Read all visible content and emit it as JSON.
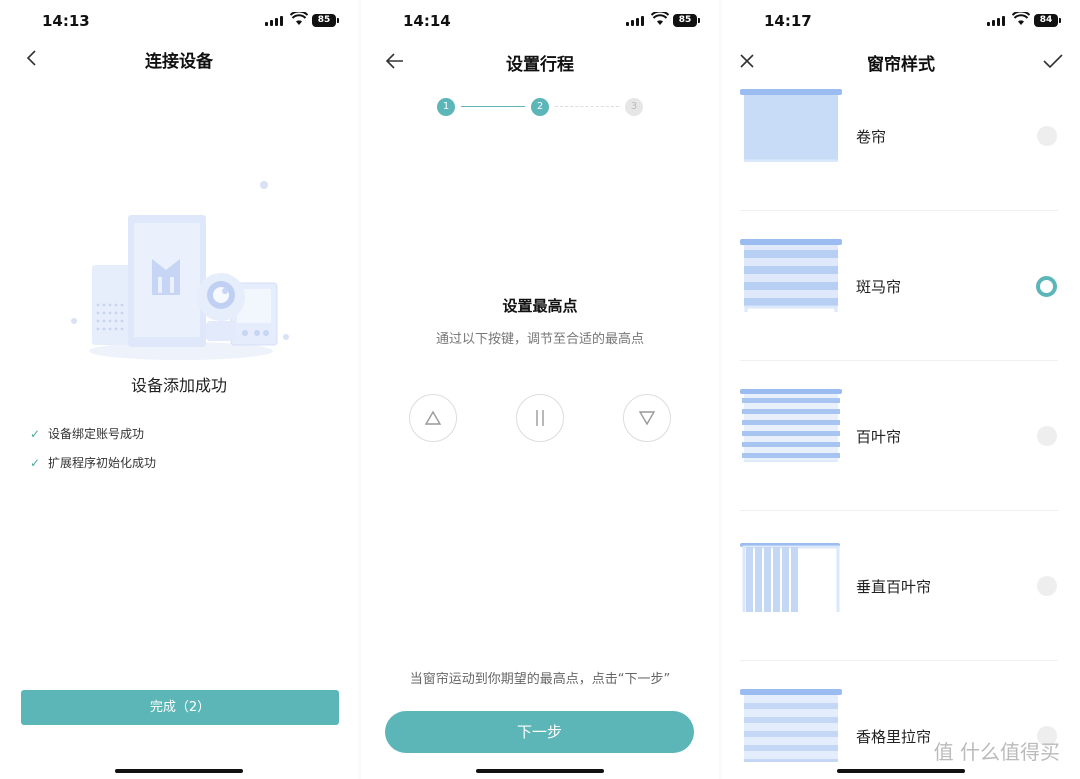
{
  "panel1": {
    "status": {
      "time": "14:13",
      "battery": "85"
    },
    "title": "连接设备",
    "success_text": "设备添加成功",
    "checks": [
      "设备绑定账号成功",
      "扩展程序初始化成功"
    ],
    "done_button": "完成（2）"
  },
  "panel2": {
    "status": {
      "time": "14:14",
      "battery": "85"
    },
    "title": "设置行程",
    "steps": [
      "1",
      "2",
      "3"
    ],
    "current_step": 2,
    "heading": "设置最高点",
    "subtitle": "通过以下按键，调节至合适的最高点",
    "controls": [
      "up-icon",
      "pause-icon",
      "down-icon"
    ],
    "hint": "当窗帘运动到你期望的最高点，点击“下一步”",
    "next_button": "下一步"
  },
  "panel3": {
    "status": {
      "time": "14:17",
      "battery": "84"
    },
    "title": "窗帘样式",
    "options": [
      {
        "label": "卷帘",
        "selected": false
      },
      {
        "label": "斑马帘",
        "selected": true
      },
      {
        "label": "百叶帘",
        "selected": false
      },
      {
        "label": "垂直百叶帘",
        "selected": false
      },
      {
        "label": "香格里拉帘",
        "selected": false
      }
    ],
    "watermark": "值 什么值得买"
  },
  "colors": {
    "accent": "#5cb6b8",
    "blind": "#c9dcf7",
    "blind_dark": "#9bbcf0"
  }
}
